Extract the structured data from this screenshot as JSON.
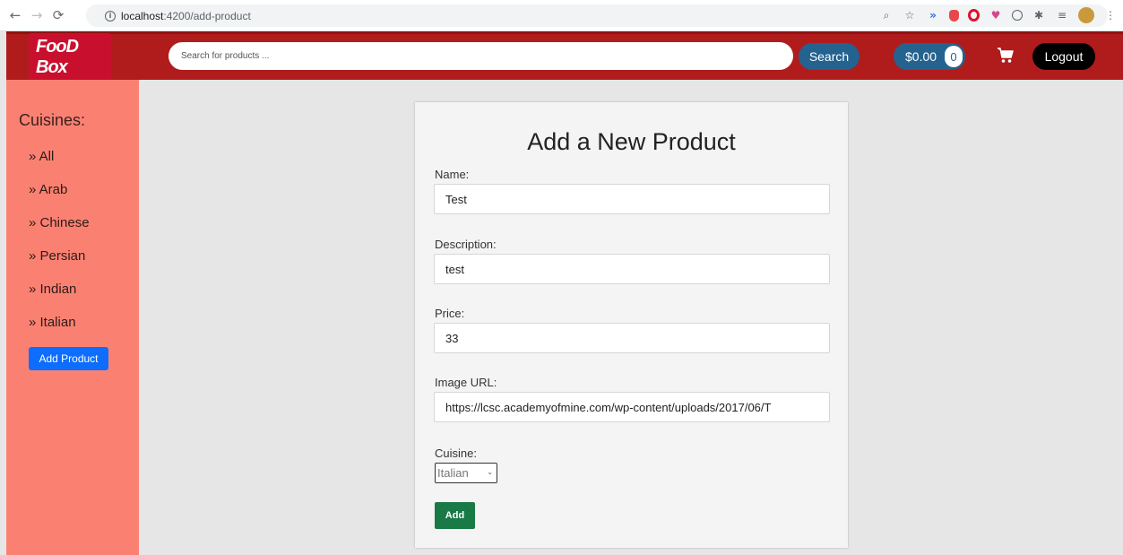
{
  "browser": {
    "url_host": "localhost",
    "url_path": ":4200/add-product"
  },
  "header": {
    "logo_text": "FooD Box",
    "search_placeholder": "Search for products ...",
    "search_label": "Search",
    "cart_total": "$0.00",
    "cart_count": "0",
    "logout_label": "Logout"
  },
  "sidebar": {
    "title": "Cuisines:",
    "items": [
      "» All",
      "» Arab",
      "» Chinese",
      "» Persian",
      "» Indian",
      "» Italian"
    ],
    "add_product_label": "Add Product"
  },
  "form": {
    "title": "Add a New Product",
    "name_label": "Name:",
    "name_value": "Test",
    "description_label": "Description:",
    "description_value": "test",
    "price_label": "Price:",
    "price_value": "33",
    "image_label": "Image URL:",
    "image_value": "https://lcsc.academyofmine.com/wp-content/uploads/2017/06/T",
    "cuisine_label": "Cuisine:",
    "cuisine_value": "Italian",
    "submit_label": "Add"
  },
  "colors": {
    "navbar": "#b01c1c",
    "sidebar": "#fa8171",
    "primary_blue": "#24628f",
    "add_product_blue": "#0d6efd",
    "submit_green": "#1a7a47"
  }
}
